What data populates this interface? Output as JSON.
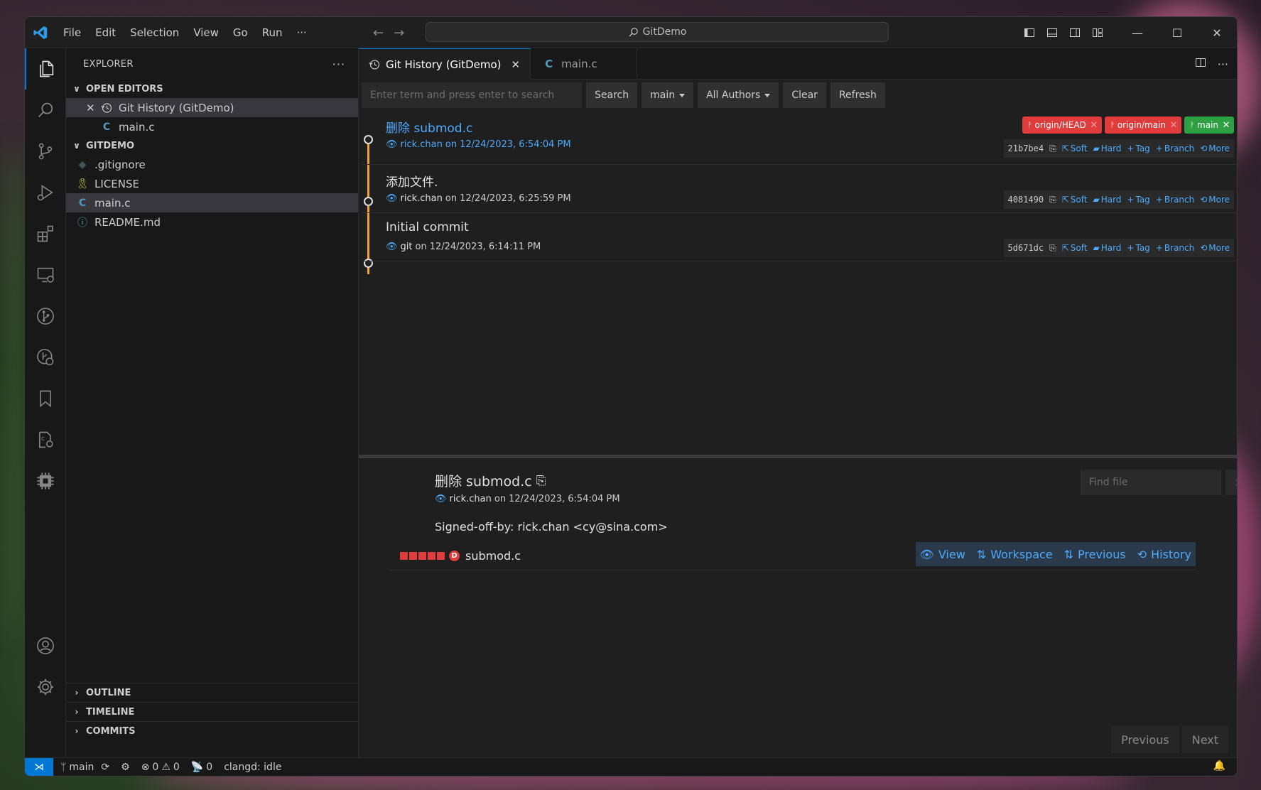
{
  "menu": [
    "File",
    "Edit",
    "Selection",
    "View",
    "Go",
    "Run",
    "···"
  ],
  "command_center": "GitDemo",
  "sidebar": {
    "title": "EXPLORER",
    "open_editors": {
      "title": "OPEN EDITORS",
      "items": [
        {
          "label": "Git History (GitDemo)"
        },
        {
          "label": "main.c"
        }
      ]
    },
    "gitdemo": {
      "title": "GITDEMO",
      "items": [
        {
          "label": ".gitignore"
        },
        {
          "label": "LICENSE"
        },
        {
          "label": "main.c"
        },
        {
          "label": "README.md"
        }
      ]
    },
    "outline": "OUTLINE",
    "timeline": "TIMELINE",
    "commits": "COMMITS"
  },
  "tabs": [
    {
      "label": "Git History (GitDemo)"
    },
    {
      "label": "main.c"
    }
  ],
  "toolbar": {
    "search_placeholder": "Enter term and press enter to search",
    "search": "Search",
    "branch": "main",
    "authors": "All Authors",
    "clear": "Clear",
    "refresh": "Refresh"
  },
  "commits": [
    {
      "message": "删除 submod.c",
      "author": "rick.chan",
      "on": "on",
      "date": "12/24/2023, 6:54:04 PM",
      "hash": "21b7be4",
      "refs": [
        {
          "label": "origin/HEAD",
          "color": "#e03c3c"
        },
        {
          "label": "origin/main",
          "color": "#e03c3c"
        },
        {
          "label": "main",
          "color": "#2ea043"
        }
      ]
    },
    {
      "message": "添加文件.",
      "author": "rick.chan",
      "on": "on",
      "date": "12/24/2023, 6:25:59 PM",
      "hash": "4081490",
      "refs": []
    },
    {
      "message": "Initial commit",
      "author": "git",
      "on": "on",
      "date": "12/24/2023, 6:14:11 PM",
      "hash": "5d671dc",
      "refs": []
    }
  ],
  "commit_actions": {
    "soft": "Soft",
    "hard": "Hard",
    "tag": "Tag",
    "branch": "Branch",
    "more": "More"
  },
  "details": {
    "title": "删除 submod.c",
    "author": "rick.chan",
    "on": "on",
    "date": "12/24/2023, 6:54:04 PM",
    "body": "Signed-off-by: rick.chan <cy@sina.com>",
    "find_placeholder": "Find file",
    "file": {
      "badge": "D",
      "name": "submod.c"
    },
    "file_actions": {
      "view": "View",
      "workspace": "Workspace",
      "previous": "Previous",
      "history": "History"
    },
    "pager": {
      "previous": "Previous",
      "next": "Next"
    }
  },
  "statusbar": {
    "branch": "main",
    "errors": "0",
    "warnings": "0",
    "ports": "0",
    "clangd": "clangd: idle"
  },
  "colors": {
    "accent": "#0078d4",
    "link": "#4daafc",
    "graph": "#f5a623",
    "ref_red": "#e03c3c",
    "ref_green": "#2ea043"
  }
}
